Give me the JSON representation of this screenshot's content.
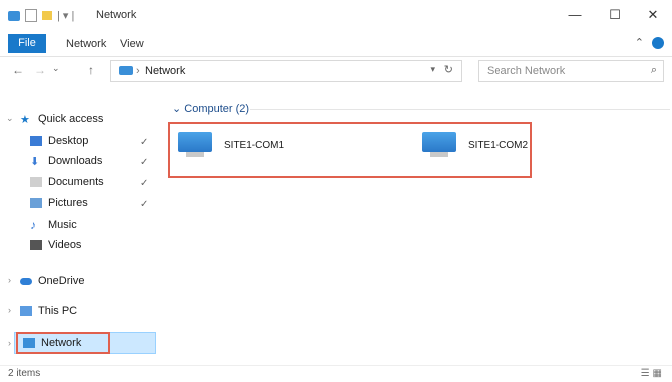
{
  "window": {
    "title": "Network",
    "path_prefix": "| ▾ |",
    "minimize": "—",
    "maximize": "☐",
    "close": "✕"
  },
  "ribbon": {
    "tabs": [
      "File",
      "Network",
      "View"
    ]
  },
  "address_bar": {
    "back": "←",
    "forward": "→",
    "recent": "⌄",
    "up": "↑",
    "location": "Network",
    "refresh": "↻",
    "search_placeholder": "Search Network"
  },
  "nav": {
    "quick_access": "Quick access",
    "items": [
      {
        "label": "Desktop",
        "pinned": true
      },
      {
        "label": "Downloads",
        "pinned": true
      },
      {
        "label": "Documents",
        "pinned": true
      },
      {
        "label": "Pictures",
        "pinned": true
      },
      {
        "label": "Music",
        "pinned": false
      },
      {
        "label": "Videos",
        "pinned": false
      }
    ],
    "onedrive": "OneDrive",
    "this_pc": "This PC",
    "network": "Network"
  },
  "content": {
    "group_header": "Computer (2)",
    "computers": [
      "SITE1-COM1",
      "SITE1-COM2"
    ]
  },
  "status": {
    "items": "2 items"
  },
  "colors": {
    "accent": "#1979ca",
    "highlight": "#e0604e",
    "selection": "#cce8ff"
  }
}
